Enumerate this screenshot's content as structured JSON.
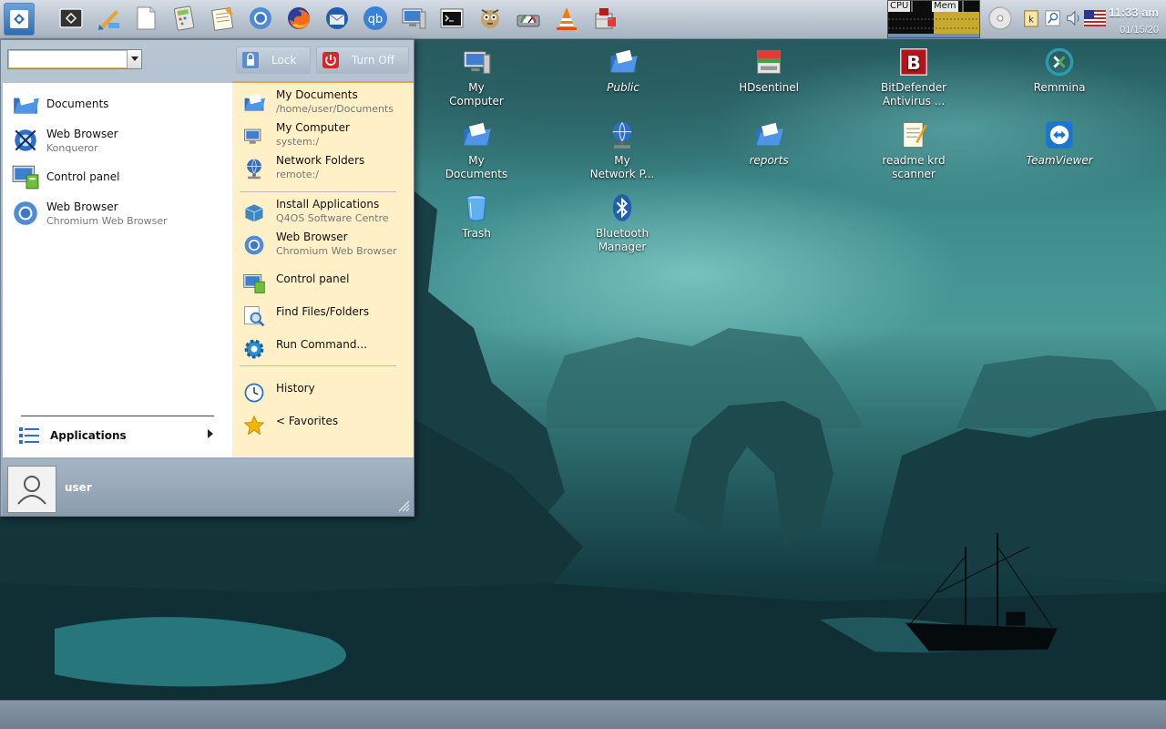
{
  "taskbar": {
    "cpu_label": "CPU",
    "mem_label": "Mem",
    "clock_time": "11:33 am",
    "clock_date": "01/15/20",
    "launchers": [
      "app-launcher-icon",
      "brush-icon",
      "blank-document-icon",
      "calculator-icon",
      "notepad-icon",
      "chromium-icon",
      "firefox-icon",
      "thunderbird-icon",
      "qbittorrent-icon",
      "my-computer-icon",
      "terminal-icon",
      "gimp-icon",
      "disk-gauge-icon",
      "vlc-icon",
      "package-icon"
    ]
  },
  "startmenu": {
    "search_value": "",
    "lock_label": "Lock",
    "turnoff_label": "Turn Off",
    "left_items": [
      {
        "title": "Documents",
        "subtitle": ""
      },
      {
        "title": "Web Browser",
        "subtitle": "Konqueror"
      },
      {
        "title": "Control panel",
        "subtitle": ""
      },
      {
        "title": "Web Browser",
        "subtitle": "Chromium Web Browser"
      }
    ],
    "right_items": [
      {
        "title": "My Documents",
        "subtitle": "/home/user/Documents"
      },
      {
        "title": "My Computer",
        "subtitle": "system:/"
      },
      {
        "title": "Network Folders",
        "subtitle": "remote:/"
      },
      {
        "title": "Install Applications",
        "subtitle": "Q4OS Software Centre"
      },
      {
        "title": "Web Browser",
        "subtitle": "Chromium Web Browser"
      },
      {
        "title": "Control panel",
        "subtitle": ""
      },
      {
        "title": "Find Files/Folders",
        "subtitle": ""
      },
      {
        "title": "Run Command...",
        "subtitle": ""
      },
      {
        "title": "History",
        "subtitle": ""
      },
      {
        "title": "<  Favorites",
        "subtitle": ""
      }
    ],
    "applications_label": "Applications",
    "user_label": "user"
  },
  "desktop": {
    "icons": [
      {
        "line1": "My",
        "line2": "Computer"
      },
      {
        "line1": "Public",
        "line2": ""
      },
      {
        "line1": "HDsentinel",
        "line2": ""
      },
      {
        "line1": "BitDefender",
        "line2": "Antivirus ..."
      },
      {
        "line1": "Remmina",
        "line2": ""
      },
      {
        "line1": "My",
        "line2": "Documents"
      },
      {
        "line1": "My",
        "line2": "Network P..."
      },
      {
        "line1": "reports",
        "line2": ""
      },
      {
        "line1": "readme krd",
        "line2": "scanner"
      },
      {
        "line1": "TeamViewer",
        "line2": ""
      },
      {
        "line1": "Trash",
        "line2": ""
      },
      {
        "line1": "Bluetooth",
        "line2": "Manager"
      }
    ]
  },
  "colors": {
    "menu_accent": "#e9a14b",
    "menu_right_bg": "#fff0c7",
    "turnoff_red": "#d9262a"
  }
}
